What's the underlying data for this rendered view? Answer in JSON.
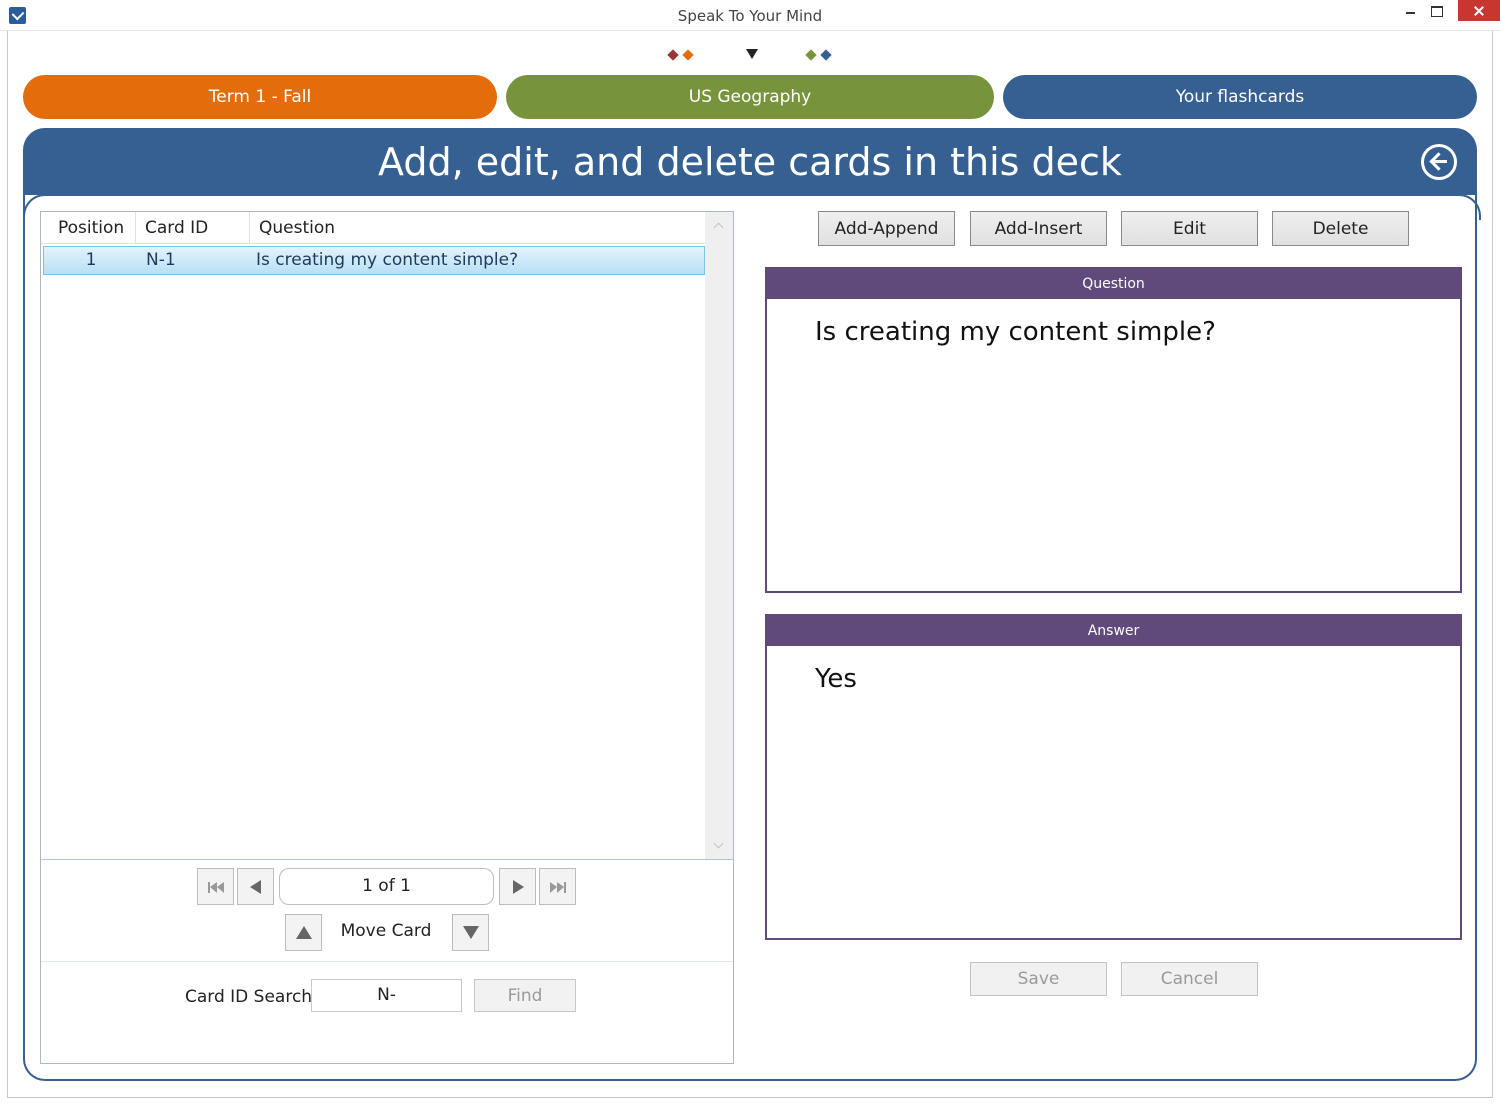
{
  "window": {
    "title": "Speak To Your Mind"
  },
  "colors": {
    "orange": "#e46c0a",
    "green": "#77933c",
    "blue": "#366092",
    "purple": "#604a7b",
    "dark_red": "#953735"
  },
  "nav": {
    "pills": [
      {
        "label": "Term 1 - Fall"
      },
      {
        "label": "US Geography"
      },
      {
        "label": "Your flashcards"
      }
    ]
  },
  "header": {
    "title": "Add, edit, and delete cards in this deck",
    "back_icon": "back-arrow-circle-icon"
  },
  "grid": {
    "columns": [
      "Position",
      "Card ID",
      "Question"
    ],
    "rows": [
      {
        "position": "1",
        "card_id": "N-1",
        "question": "Is creating my content simple?"
      }
    ]
  },
  "pager": {
    "page_text": "1 of 1",
    "move_label": "Move Card"
  },
  "search": {
    "label": "Card ID Search",
    "value": "N-",
    "find_label": "Find"
  },
  "actions": {
    "add_append": "Add-Append",
    "add_insert": "Add-Insert",
    "edit": "Edit",
    "delete": "Delete",
    "save": "Save",
    "cancel": "Cancel"
  },
  "card": {
    "question_header": "Question",
    "question_text": "Is creating my content simple?",
    "answer_header": "Answer",
    "answer_text": "Yes"
  }
}
